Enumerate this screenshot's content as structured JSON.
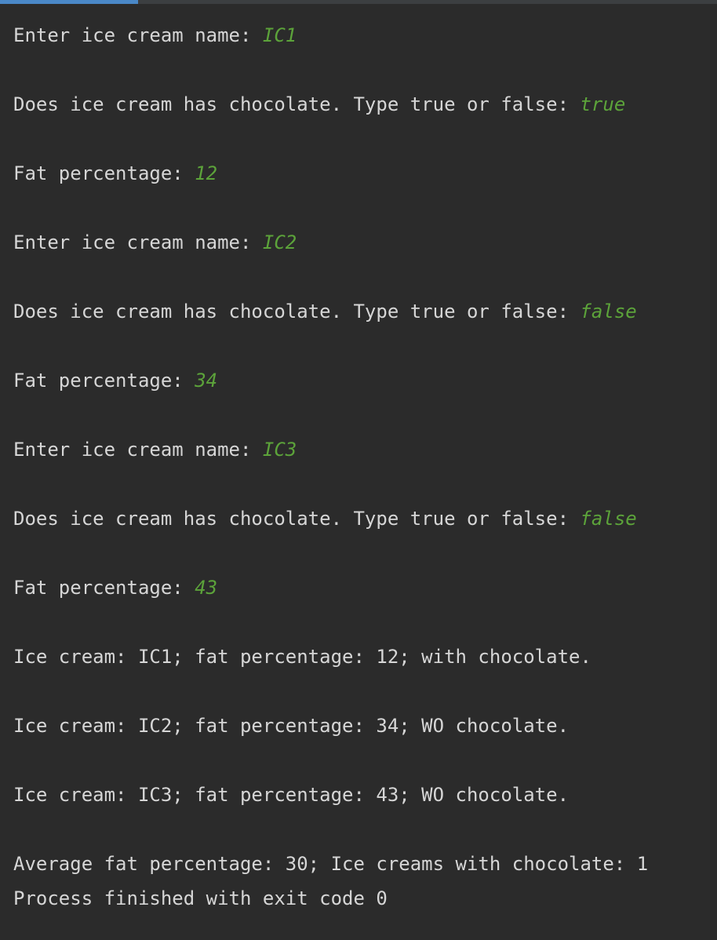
{
  "colors": {
    "background": "#2b2b2b",
    "output_text": "#d6d6d6",
    "user_input": "#5ca33a",
    "tab_indicator": "#4a88c7"
  },
  "console": {
    "lines": [
      {
        "prompt": "Enter ice cream name: ",
        "input": "IC1"
      },
      {
        "prompt": "Does ice cream has chocolate. Type true or false: ",
        "input": "true"
      },
      {
        "prompt": "Fat percentage: ",
        "input": "12"
      },
      {
        "prompt": "Enter ice cream name: ",
        "input": "IC2"
      },
      {
        "prompt": "Does ice cream has chocolate. Type true or false: ",
        "input": "false"
      },
      {
        "prompt": "Fat percentage: ",
        "input": "34"
      },
      {
        "prompt": "Enter ice cream name: ",
        "input": "IC3"
      },
      {
        "prompt": "Does ice cream has chocolate. Type true or false: ",
        "input": "false"
      },
      {
        "prompt": "Fat percentage: ",
        "input": "43"
      },
      {
        "text": "Ice cream: IC1; fat percentage: 12; with chocolate."
      },
      {
        "text": "Ice cream: IC2; fat percentage: 34; WO chocolate."
      },
      {
        "text": "Ice cream: IC3; fat percentage: 43; WO chocolate."
      },
      {
        "text": "Average fat percentage: 30; Ice creams with chocolate: 1"
      },
      {
        "text": "Process finished with exit code 0"
      }
    ]
  }
}
